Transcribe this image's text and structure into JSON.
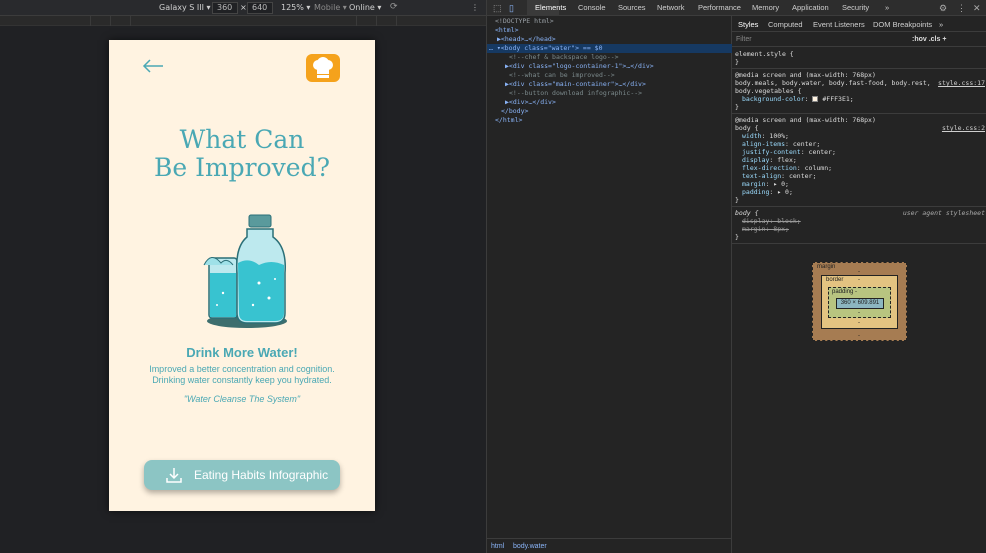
{
  "device_toolbar": {
    "device": "Galaxy S III ▾",
    "width": "360",
    "times": "×",
    "height": "640",
    "zoom": "125% ▾",
    "mode": "Mobile ▾",
    "network": "Online ▾"
  },
  "page": {
    "title_line1": "What Can",
    "title_line2": "Be Improved?",
    "headline": "Drink More Water!",
    "desc_line1": "Improved a better concentration and cognition.",
    "desc_line2": "Drinking water constantly keep you hydrated.",
    "quote": "\"Water Cleanse The System\"",
    "download_label": "Eating Habits Infographic",
    "colors": {
      "background": "#FFF3E1",
      "accent": "#4AA8B4",
      "button": "#8CC5C4",
      "chef": "#F5A21C"
    }
  },
  "devtools": {
    "tabs": [
      "Elements",
      "Console",
      "Sources",
      "Network",
      "Performance",
      "Memory",
      "Application",
      "Security",
      "»"
    ],
    "dom": [
      "<!DOCTYPE html>",
      "<html>",
      "▶<head>…</head>",
      "… ▾<body class=\"water\"> == $0",
      "<!--chef & backspace logo-->",
      "▶<div class=\"logo-container-1\">…</div>",
      "<!--what can be improved-->",
      "▶<div class=\"main-container\">…</div>",
      "<!--button download infographic-->",
      "▶<div>…</div>",
      "</body>",
      "</html>"
    ],
    "breadcrumbs": [
      "html",
      "body.water"
    ],
    "styles_tabs": [
      "Styles",
      "Computed",
      "Event Listeners",
      "DOM Breakpoints",
      "»"
    ],
    "filter_placeholder": "Filter",
    "filter_hov": ":hov  .cls  +",
    "rules": {
      "element_style": "element.style {",
      "close": "}",
      "media1": "@media screen and (max-width: 768px)",
      "sel1a": "body.meals, body.water, body.fast-food, body.rest,",
      "sel1b": "body.vegetables {",
      "link1": "style.css:17",
      "prop_bg": "background-color",
      "val_bg": "#FFF3E1;",
      "media2": "@media screen and (max-width: 768px)",
      "sel2": "body {",
      "link2": "style.css:2",
      "props": [
        [
          "width",
          "100%;"
        ],
        [
          "align-items",
          "center;"
        ],
        [
          "justify-content",
          "center;"
        ],
        [
          "display",
          "flex;"
        ],
        [
          "flex-direction",
          "column;"
        ],
        [
          "text-align",
          "center;"
        ],
        [
          "margin",
          "▸ 0;"
        ],
        [
          "padding",
          "▸ 0;"
        ]
      ],
      "ua_sel": "body {",
      "ua_label": "user agent stylesheet",
      "ua_props": [
        "display: block;",
        "margin: 8px;"
      ]
    },
    "box_model": {
      "margin": "margin",
      "border": "border",
      "padding": "padding -",
      "content": "360 × 609.891",
      "dash": "-"
    }
  }
}
